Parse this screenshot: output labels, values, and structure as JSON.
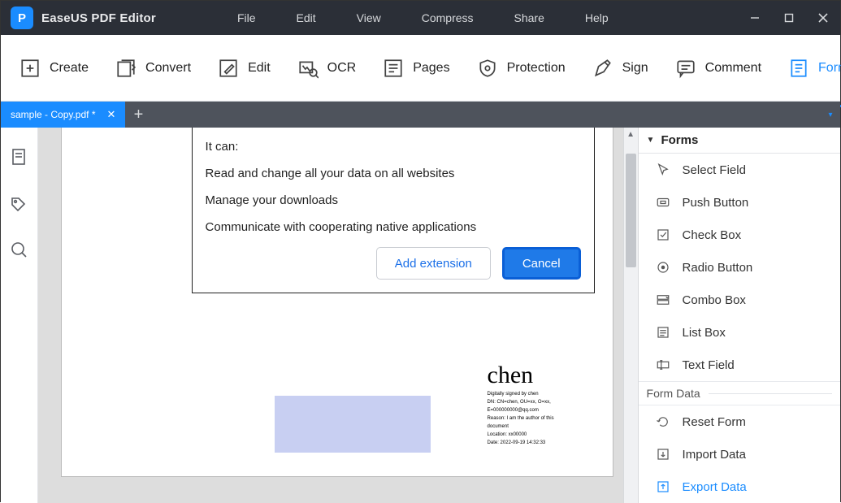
{
  "app_title": "EaseUS PDF Editor",
  "menu": [
    "File",
    "Edit",
    "View",
    "Compress",
    "Share",
    "Help"
  ],
  "toolbar": [
    {
      "id": "create",
      "label": "Create"
    },
    {
      "id": "convert",
      "label": "Convert"
    },
    {
      "id": "edit",
      "label": "Edit"
    },
    {
      "id": "ocr",
      "label": "OCR"
    },
    {
      "id": "pages",
      "label": "Pages"
    },
    {
      "id": "protection",
      "label": "Protection"
    },
    {
      "id": "sign",
      "label": "Sign"
    },
    {
      "id": "comment",
      "label": "Comment"
    },
    {
      "id": "forms",
      "label": "Forms"
    }
  ],
  "tab_name": "sample - Copy.pdf *",
  "dialog": {
    "lead": "It can:",
    "perm1": "Read and change all your data on all websites",
    "perm2": "Manage your downloads",
    "perm3": "Communicate with cooperating native applications",
    "add": "Add extension",
    "cancel": "Cancel"
  },
  "signature": {
    "name": "chen",
    "l1": "Digitally signed by chen",
    "l2": "DN: CN=chen, OU=xx, O=xx,",
    "l3": "E=000000000@qq.com",
    "l4": "Reason: I am the author of this",
    "l5": "document",
    "l6": "Location: xx00000",
    "l7": "Date: 2022-09-19 14:32:33"
  },
  "right": {
    "header": "Forms",
    "items": [
      {
        "label": "Select Field"
      },
      {
        "label": "Push Button"
      },
      {
        "label": "Check Box"
      },
      {
        "label": "Radio Button"
      },
      {
        "label": "Combo Box"
      },
      {
        "label": "List Box"
      },
      {
        "label": "Text Field"
      }
    ],
    "group": "Form Data",
    "data_items": [
      {
        "label": "Reset Form"
      },
      {
        "label": "Import Data"
      },
      {
        "label": "Export Data"
      }
    ]
  }
}
